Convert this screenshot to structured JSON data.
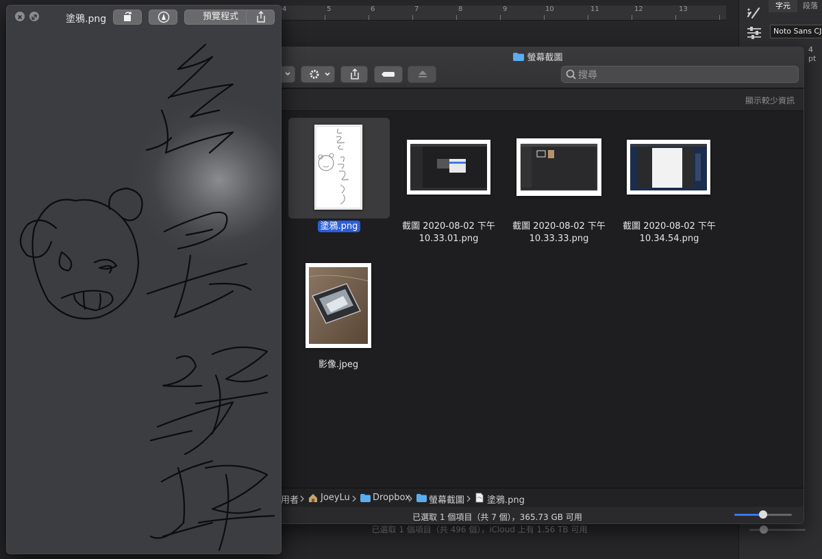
{
  "background_app": {
    "ruler_numbers": [
      "4",
      "5",
      "6",
      "7",
      "8",
      "9",
      "10",
      "11",
      "12",
      "13"
    ],
    "panel_tabs": {
      "character": "字元",
      "paragraph": "段落"
    },
    "font_name": "Noto Sans CJ",
    "font_size": "4 pt",
    "status_text": "已選取 1 個項目（共 496 個），iCloud 上有 1.56 TB 可用"
  },
  "finder": {
    "window_title": "螢幕截圖",
    "search_placeholder": "搜尋",
    "show_less_label": "顯示較少資訊",
    "items": [
      {
        "name": "塗鴉.png",
        "selected": true
      },
      {
        "name_line1": "截圖 2020-08-02 下午",
        "name_line2": "10.33.01.png"
      },
      {
        "name_line1": "截圖 2020-08-02 下午",
        "name_line2": "10.33.33.png"
      },
      {
        "name_line1": "截圖 2020-08-02 下午",
        "name_line2": "10.34.54.png"
      },
      {
        "name": "影像.jpeg"
      }
    ],
    "path_bar": [
      "用者",
      "JoeyLu",
      "Dropbox",
      "螢幕截圖",
      "塗鴉.png"
    ],
    "status_text": "已選取 1 個項目（共 7 個），365.73 GB 可用",
    "zoom_level": 0.5
  },
  "quicklook": {
    "filename": "塗鴉.png",
    "open_with_label": "預覽程式"
  }
}
